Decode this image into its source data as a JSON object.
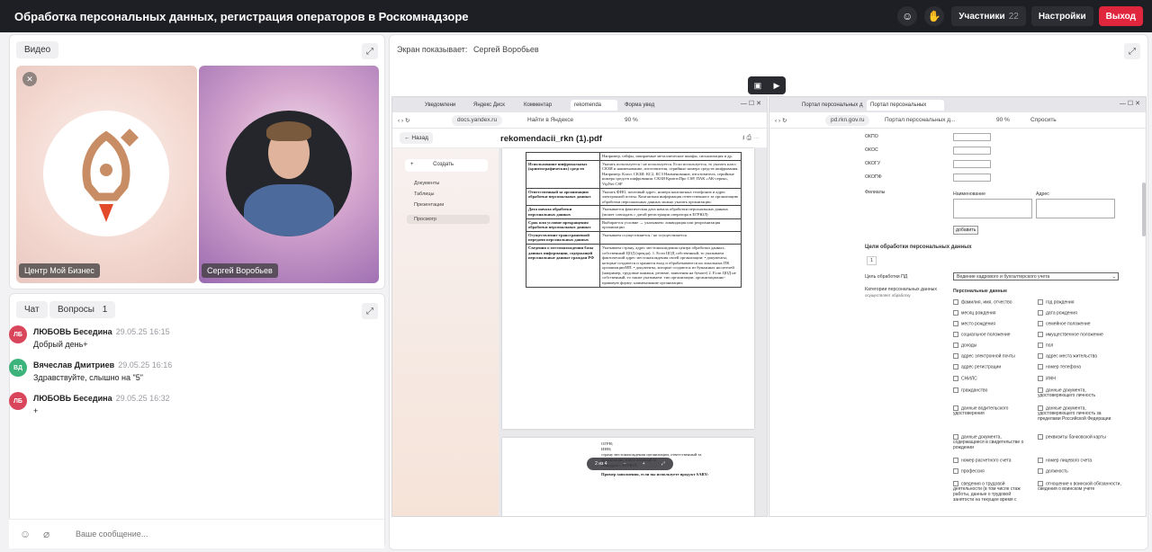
{
  "topbar": {
    "title": "Обработка персональных данных, регистрация операторов в Роскомнадзоре",
    "participants_label": "Участники",
    "participants_count": "22",
    "settings_label": "Настройки",
    "exit_label": "Выход",
    "accent": "#e0263d"
  },
  "video": {
    "tab_label": "Видео",
    "tiles": [
      {
        "name": "Центр Мой Бизнес"
      },
      {
        "name": "Сергей Воробьев"
      }
    ]
  },
  "chat": {
    "tabs": [
      {
        "label": "Чат"
      },
      {
        "label": "Вопросы",
        "count": "1"
      }
    ],
    "messages": [
      {
        "initials": "ЛБ",
        "author": "ЛЮБОВЬ Беседина",
        "time": "29.05.25 16:15",
        "text": "Добрый день+",
        "color": "#d9455b"
      },
      {
        "initials": "ВД",
        "author": "Вячеслав Дмитриев",
        "time": "29.05.25 16:16",
        "text": "Здравствуйте, слышно на \"5\"",
        "color": "#3bb37a"
      },
      {
        "initials": "ЛБ",
        "author": "ЛЮБОВЬ Беседина",
        "time": "29.05.25 16:32",
        "text": "+",
        "color": "#d9455b"
      }
    ],
    "input_placeholder": "Ваше сообщение..."
  },
  "screen": {
    "presenter_label": "Экран показывает:",
    "presenter_name": "Сергей Воробьев",
    "left_browser": {
      "tabs": [
        "Уведомлени",
        "Яндекс Диск",
        "Комментар",
        "rekomenda",
        "Форма увед"
      ],
      "url": "docs.yandex.ru",
      "search_label": "Найти в Яндексе",
      "zoom": "90 %",
      "back_label": "Назад",
      "file_name": "rekomendacii_rkn (1).pdf",
      "sidebar": {
        "create_label": "Создать",
        "items": [
          "Документы",
          "Таблицы",
          "Презентации",
          "Просмотр"
        ]
      },
      "table_rows": [
        {
          "c1": "",
          "c2": "Например, сейфы, запираемые металлические шкафы, сигнализация и др."
        },
        {
          "c1": "Использование шифровальных (криптографических) средств",
          "c2": "Указать используется / не используется. Если используется, то указать класс СКЗИ и наименование, изготовителя, серийные номера средств шифрования. Например: Класс СКЗИ: КС2, КС3 Наименование, изготовитель, серийные номера средств шифрования. СКЗИ КриптоПро CSP, ПАК «АК-серия», VipNet CSP"
        },
        {
          "c1": "Ответственный за организацию обработки персональных данных",
          "c2": "Указать ФИО, почтовый адрес, номера контактных телефонов и адрес электронной почты. Контактная информация ответственного за организацию обработки персональных данных можно указать организации."
        },
        {
          "c1": "Дата начала обработки персональных данных",
          "c2": "Указывается фактическая дата начала обработки персональных данных (может совпадать с датой регистрации оператора в ЕГРЮЛ)"
        },
        {
          "c1": "Срок или условие прекращения обработки персональных данных",
          "c2": "Выбирается условие → указываем: ликвидация или реорганизация организации"
        },
        {
          "c1": "Осуществление трансграничной передачи персональных данных",
          "c2": "Указываем осуществляется / не осуществляется"
        },
        {
          "c1": "Сведения о местонахождении базы данных информации, содержащей персональные данные граждан РФ",
          "c2": "Указываем страну, адрес местонахождения центра обработки данных, собственный ЦОД (аренда). 1. Если ЦОД собственный, то указываем фактический адрес местонахождения своей организации: • документы, которые создаются и хранятся вход и обрабатываются на локальных ПК организации/ИП. • документы, которые создаются из бумажных носителей (например, трудовые книжки, резюме, заявления на бумаге) 2. Если ЦОД не собственный, то также указываем: тип организации; организационно-правовую форму; наименование организации;"
        }
      ],
      "page2_lines": [
        "ОГРН;",
        "ИНН;",
        "страну местонахождения организации, ответственный за",
        "организации, ответственный за",
        "стандарте с ЕГРЮЛ."
      ],
      "page2_bold": "Пример заполнения, если вы используете продукт SABY:",
      "pager": "2 из 4"
    },
    "right_browser": {
      "tabs": [
        "Портал персональных да",
        "Портал персональных"
      ],
      "url": "pd.rkn.gov.ru",
      "page_title": "Портал персональных д...",
      "zoom": "90 %",
      "ask_label": "Спросить",
      "codes": [
        "ОКПО",
        "ОКОС",
        "ОКОГУ",
        "ОКОПФ"
      ],
      "branches_label": "Филиалы",
      "name_col": "Наименование",
      "address_col": "Адрес",
      "add_label": "добавить",
      "purposes_title": "Цели обработки персональных данных",
      "purpose_index": "1",
      "purpose_label": "Цель обработки ПД",
      "purpose_value": "Ведение кадрового и бухгалтерского учета",
      "categories_label": "Категории персональных данных",
      "categories_hint": "осуществляет обработку",
      "pd_title": "Персональные данные",
      "pd_left": [
        "фамилия, имя, отчество",
        "месяц рождения",
        "место рождения",
        "социальное положение",
        "доходы",
        "адрес электронной почты",
        "адрес регистрации",
        "СНИЛС",
        "гражданство",
        "данные водительского удостоверения",
        "данные документа, содержащиеся в свидетельстве о рождении",
        "номер расчетного счета",
        "профессия",
        "сведения о трудовой деятельности (в том числе стаж работы, данные о трудовой занятости на текущее время с"
      ],
      "pd_right": [
        "год рождения",
        "дата рождения",
        "семейное положение",
        "имущественное положение",
        "пол",
        "адрес места жительства",
        "номер телефона",
        "ИНН",
        "данные документа, удостоверяющего личность",
        "данные документа, удостоверяющего личность за пределами Российской Федерации",
        "реквизиты банковской карты",
        "номер лицевого счета",
        "должность",
        "отношение к воинской обязанности, сведения о воинском учете"
      ]
    }
  }
}
